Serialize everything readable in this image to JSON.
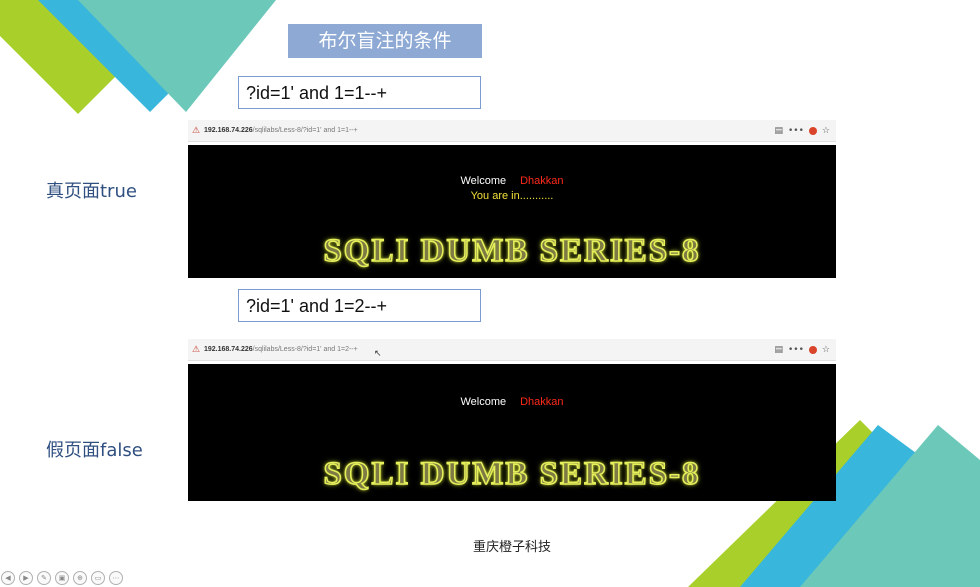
{
  "slide": {
    "title": "布尔盲注的条件",
    "query_true": "?id=1' and 1=1--+",
    "query_false": "?id=1' and 1=2--+",
    "label_true": "真页面true",
    "label_false": "假页面false",
    "footer": "重庆橙子科技"
  },
  "browser_true": {
    "url_host": "192.168.74.226",
    "url_rest": "/sqlilabs/Less-8/?id=1' and 1=1--+",
    "welcome": "Welcome",
    "name": "Dhakkan",
    "message": "You are in...........",
    "series": "SQLI DUMB SERIES-8"
  },
  "browser_false": {
    "url_host": "192.168.74.226",
    "url_rest": "/sqlilabs/Less-8/?id=1' and 1=2--+",
    "welcome": "Welcome",
    "name": "Dhakkan",
    "series": "SQLI DUMB SERIES-8"
  },
  "colors": {
    "deco_green": "#a8cf2a",
    "deco_blue": "#38b6dc",
    "deco_teal": "#6cc8b9",
    "title_bg": "#8ea9d4",
    "name_red": "#ff2a1a",
    "message_yellow": "#f2e13a"
  },
  "icons": [
    "tracking-icon",
    "menu-dots-icon",
    "ublock-icon",
    "star-icon",
    "cursor-icon"
  ]
}
